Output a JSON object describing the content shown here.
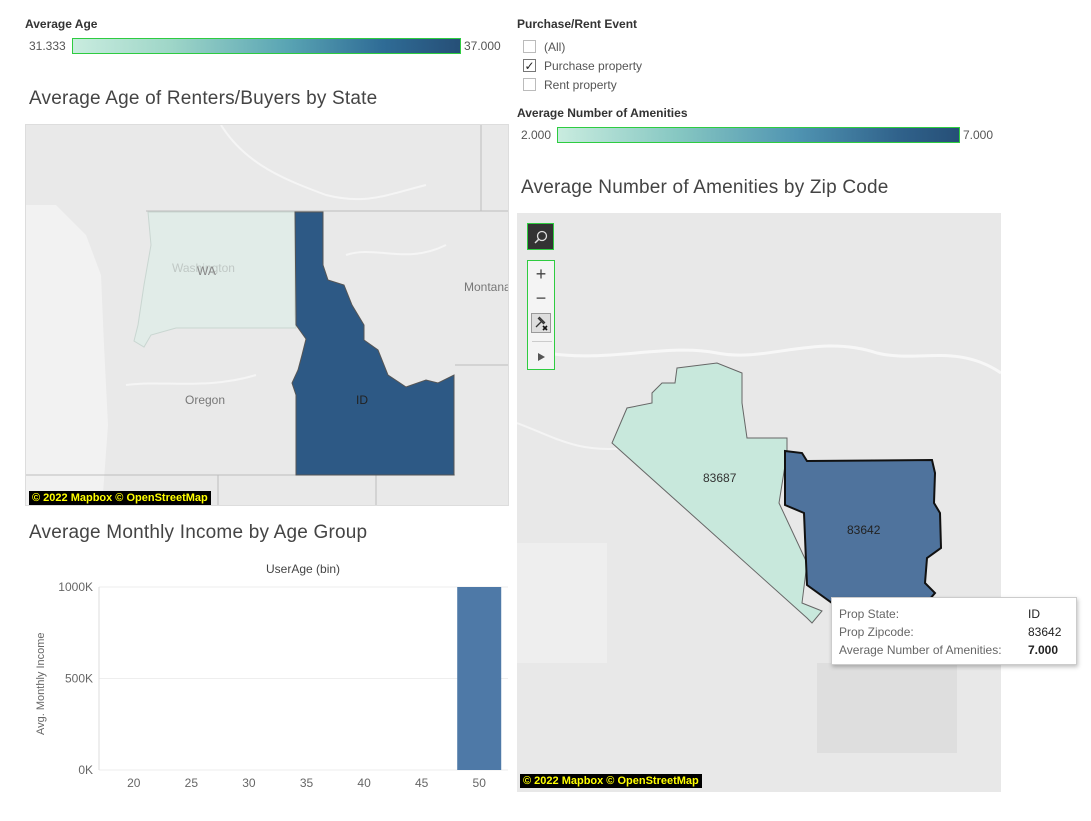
{
  "age_legend": {
    "title": "Average Age",
    "min": "31.333",
    "max": "37.000"
  },
  "filter": {
    "title": "Purchase/Rent Event",
    "options": [
      {
        "label": "(All)",
        "checked": false
      },
      {
        "label": "Purchase property",
        "checked": true
      },
      {
        "label": "Rent property",
        "checked": false
      }
    ]
  },
  "amenities_legend": {
    "title": "Average Number of Amenities",
    "min": "2.000",
    "max": "7.000"
  },
  "state_map": {
    "title": "Average Age of Renters/Buyers by State",
    "labels": {
      "washington": "Washington",
      "wa": "WA",
      "montana": "Montana",
      "oregon": "Oregon",
      "id": "ID"
    },
    "attribution": "© 2022 Mapbox © OpenStreetMap",
    "colors": {
      "wa_fill": "#e1ece8",
      "id_fill": "#2d5985"
    }
  },
  "zip_map": {
    "title": "Average Number of Amenities by Zip Code",
    "zips": {
      "z83687": "83687",
      "z83642": "83642"
    },
    "attribution": "© 2022 Mapbox © OpenStreetMap",
    "colors": {
      "z83687_fill": "#c8e8dc",
      "z83642_fill": "#4f739d"
    },
    "tools": {
      "search": "search-icon",
      "zoom_in": "+",
      "zoom_out": "−",
      "pin": "pin-icon",
      "more": "play-icon"
    },
    "tooltip": {
      "rows": [
        {
          "key": "Prop State:",
          "value": "ID"
        },
        {
          "key": "Prop Zipcode:",
          "value": "83642"
        },
        {
          "key": "Average Number of Amenities:",
          "value": "7.000"
        }
      ]
    }
  },
  "income_chart": {
    "title": "Average Monthly Income by Age Group",
    "xlabel_top": "UserAge (bin)",
    "ylabel": "Avg. Monthly Income",
    "y_ticks": [
      "1000K",
      "500K",
      "0K"
    ],
    "x_ticks": [
      "20",
      "25",
      "30",
      "35",
      "40",
      "45",
      "50"
    ]
  },
  "chart_data": {
    "type": "bar",
    "title": "Average Monthly Income by Age Group",
    "xlabel": "UserAge (bin)",
    "ylabel": "Avg. Monthly Income",
    "categories": [
      "20",
      "25",
      "30",
      "35",
      "40",
      "45",
      "50"
    ],
    "values": [
      null,
      null,
      null,
      null,
      null,
      null,
      1000000
    ],
    "ylim": [
      0,
      1000000
    ],
    "color": "#4e79a7",
    "grid": true
  }
}
